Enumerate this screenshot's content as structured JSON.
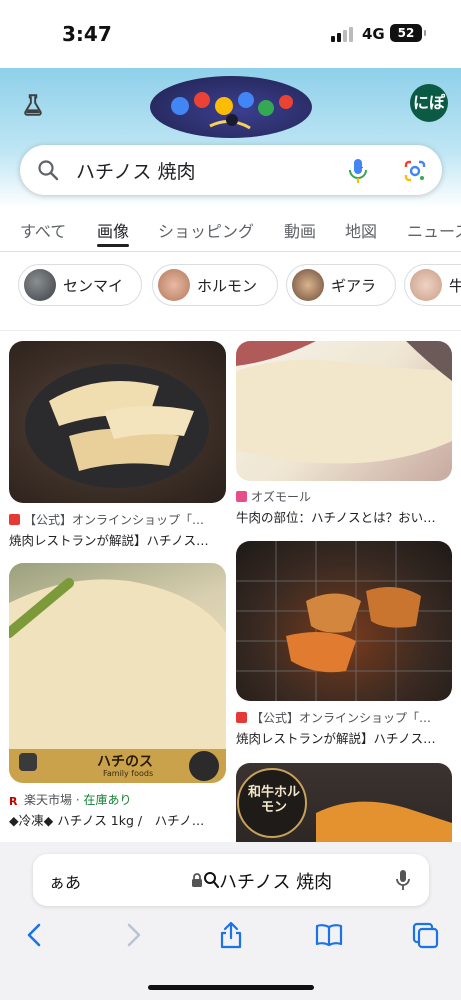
{
  "status": {
    "time": "3:47",
    "network": "4G",
    "battery": "52"
  },
  "header": {
    "avatar_text": "にぽ"
  },
  "search": {
    "query": "ハチノス 焼肉"
  },
  "tabs": [
    "すべて",
    "画像",
    "ショッピング",
    "動画",
    "地図",
    "ニュース"
  ],
  "active_tab": "画像",
  "chips": [
    {
      "label": "センマイ"
    },
    {
      "label": "ホルモン"
    },
    {
      "label": "ギアラ"
    },
    {
      "label": "牛"
    }
  ],
  "results": [
    {
      "source": "【公式】オンラインショップ「…",
      "title": "焼肉レストランが解説】ハチノス…"
    },
    {
      "source": "オズモール",
      "title": "牛肉の部位：ハチノスとは？おい…"
    },
    {
      "source": "楽天市場",
      "stock": "· 在庫あり",
      "title": "◆冷凍◆ ハチノス 1kg /　ハチノ…",
      "overlay_text": "ハチのス",
      "overlay_sub": "Family foods"
    },
    {
      "source": "【公式】オンラインショップ「…",
      "title": "焼肉レストランが解説】ハチノス…"
    },
    {
      "overlay_text": "和牛ホルモン"
    }
  ],
  "safari": {
    "aa_label": "ぁあ",
    "url_text": "ハチノス 焼肉"
  },
  "colors": {
    "google_blue": "#4285f4",
    "avatar_bg": "#0b5a43",
    "stock_green": "#188038",
    "rakuten_red": "#bf0000"
  }
}
